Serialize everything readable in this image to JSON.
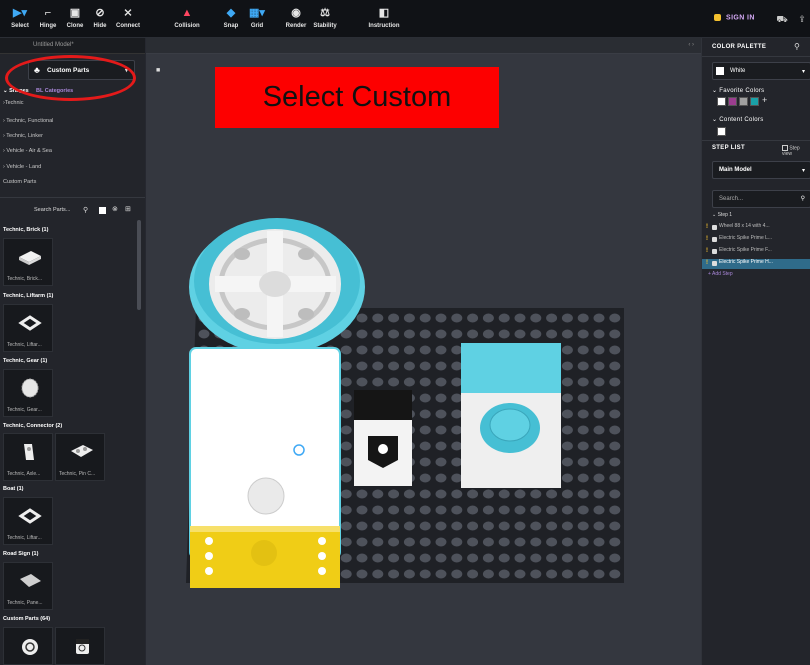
{
  "toolbar": {
    "tools": [
      {
        "label": "Select",
        "icon": "cursor-icon"
      },
      {
        "label": "Hinge",
        "icon": "hinge-icon"
      },
      {
        "label": "Clone",
        "icon": "clone-icon"
      },
      {
        "label": "Hide",
        "icon": "eye-off-icon"
      },
      {
        "label": "Connect",
        "icon": "connect-icon"
      },
      {
        "label": "Collision",
        "icon": "collision-icon"
      },
      {
        "label": "Snap",
        "icon": "snap-icon"
      },
      {
        "label": "Grid",
        "icon": "grid-icon"
      },
      {
        "label": "Render",
        "icon": "camera-icon"
      },
      {
        "label": "Stability",
        "icon": "stability-icon"
      },
      {
        "label": "Instruction",
        "icon": "instruction-icon"
      }
    ],
    "sign_in": "SIGN IN"
  },
  "left_panel": {
    "tab_label": "Untitled Model*",
    "category_select": "Custom Parts",
    "shapes_tab": "Shapes",
    "bl_tab": "BL Categories",
    "categories": [
      "Technic",
      "Technic, Functional",
      "Technic, Linker",
      "Vehicle - Air & Sea",
      "Vehicle - Land",
      "Custom Parts"
    ],
    "search_placeholder": "Search Parts...",
    "groups": [
      {
        "title": "Technic, Brick (1)",
        "parts": [
          "Technic, Brick..."
        ]
      },
      {
        "title": "Technic, Liftarm (1)",
        "parts": [
          "Technic, Liftar..."
        ]
      },
      {
        "title": "Technic, Gear (1)",
        "parts": [
          "Technic, Gear..."
        ]
      },
      {
        "title": "Technic, Connector (2)",
        "parts": [
          "Technic, Axle...",
          "Technic, Pin C..."
        ]
      },
      {
        "title": "Boat (1)",
        "parts": [
          "Technic, Liftar..."
        ]
      },
      {
        "title": "Road Sign (1)",
        "parts": [
          "Technic, Pane..."
        ]
      },
      {
        "title": "Custom Parts (64)",
        "parts": []
      }
    ]
  },
  "viewport": {
    "instruction_overlay": "Select Custom"
  },
  "right_panel": {
    "color_palette_title": "COLOR PALETTE",
    "selected_color": "White",
    "favorite_colors_title": "Favorite Colors",
    "favorite_colors": [
      "#ffffff",
      "#9b3d8f",
      "#a0a0a0",
      "#1aa1a8"
    ],
    "content_colors_title": "Content Colors",
    "content_colors": [
      "#ffffff"
    ],
    "step_list_title": "STEP LIST",
    "step_view_label": "Step view",
    "model_select": "Main Model",
    "search_placeholder": "Search...",
    "step_header": "Step 1",
    "steps": [
      "Wheel 88 x 14 with 4...",
      "Electric Spike Prime L...",
      "Electric Spike Prime F...",
      "Electric Spike Prime H..."
    ],
    "add_step": "+ Add Step"
  },
  "colors": {
    "accent_purple": "#a987d9",
    "overlay_red": "#fd0000",
    "highlight_circle": "#e41a1a",
    "selected_row": "#2f6b8a"
  }
}
